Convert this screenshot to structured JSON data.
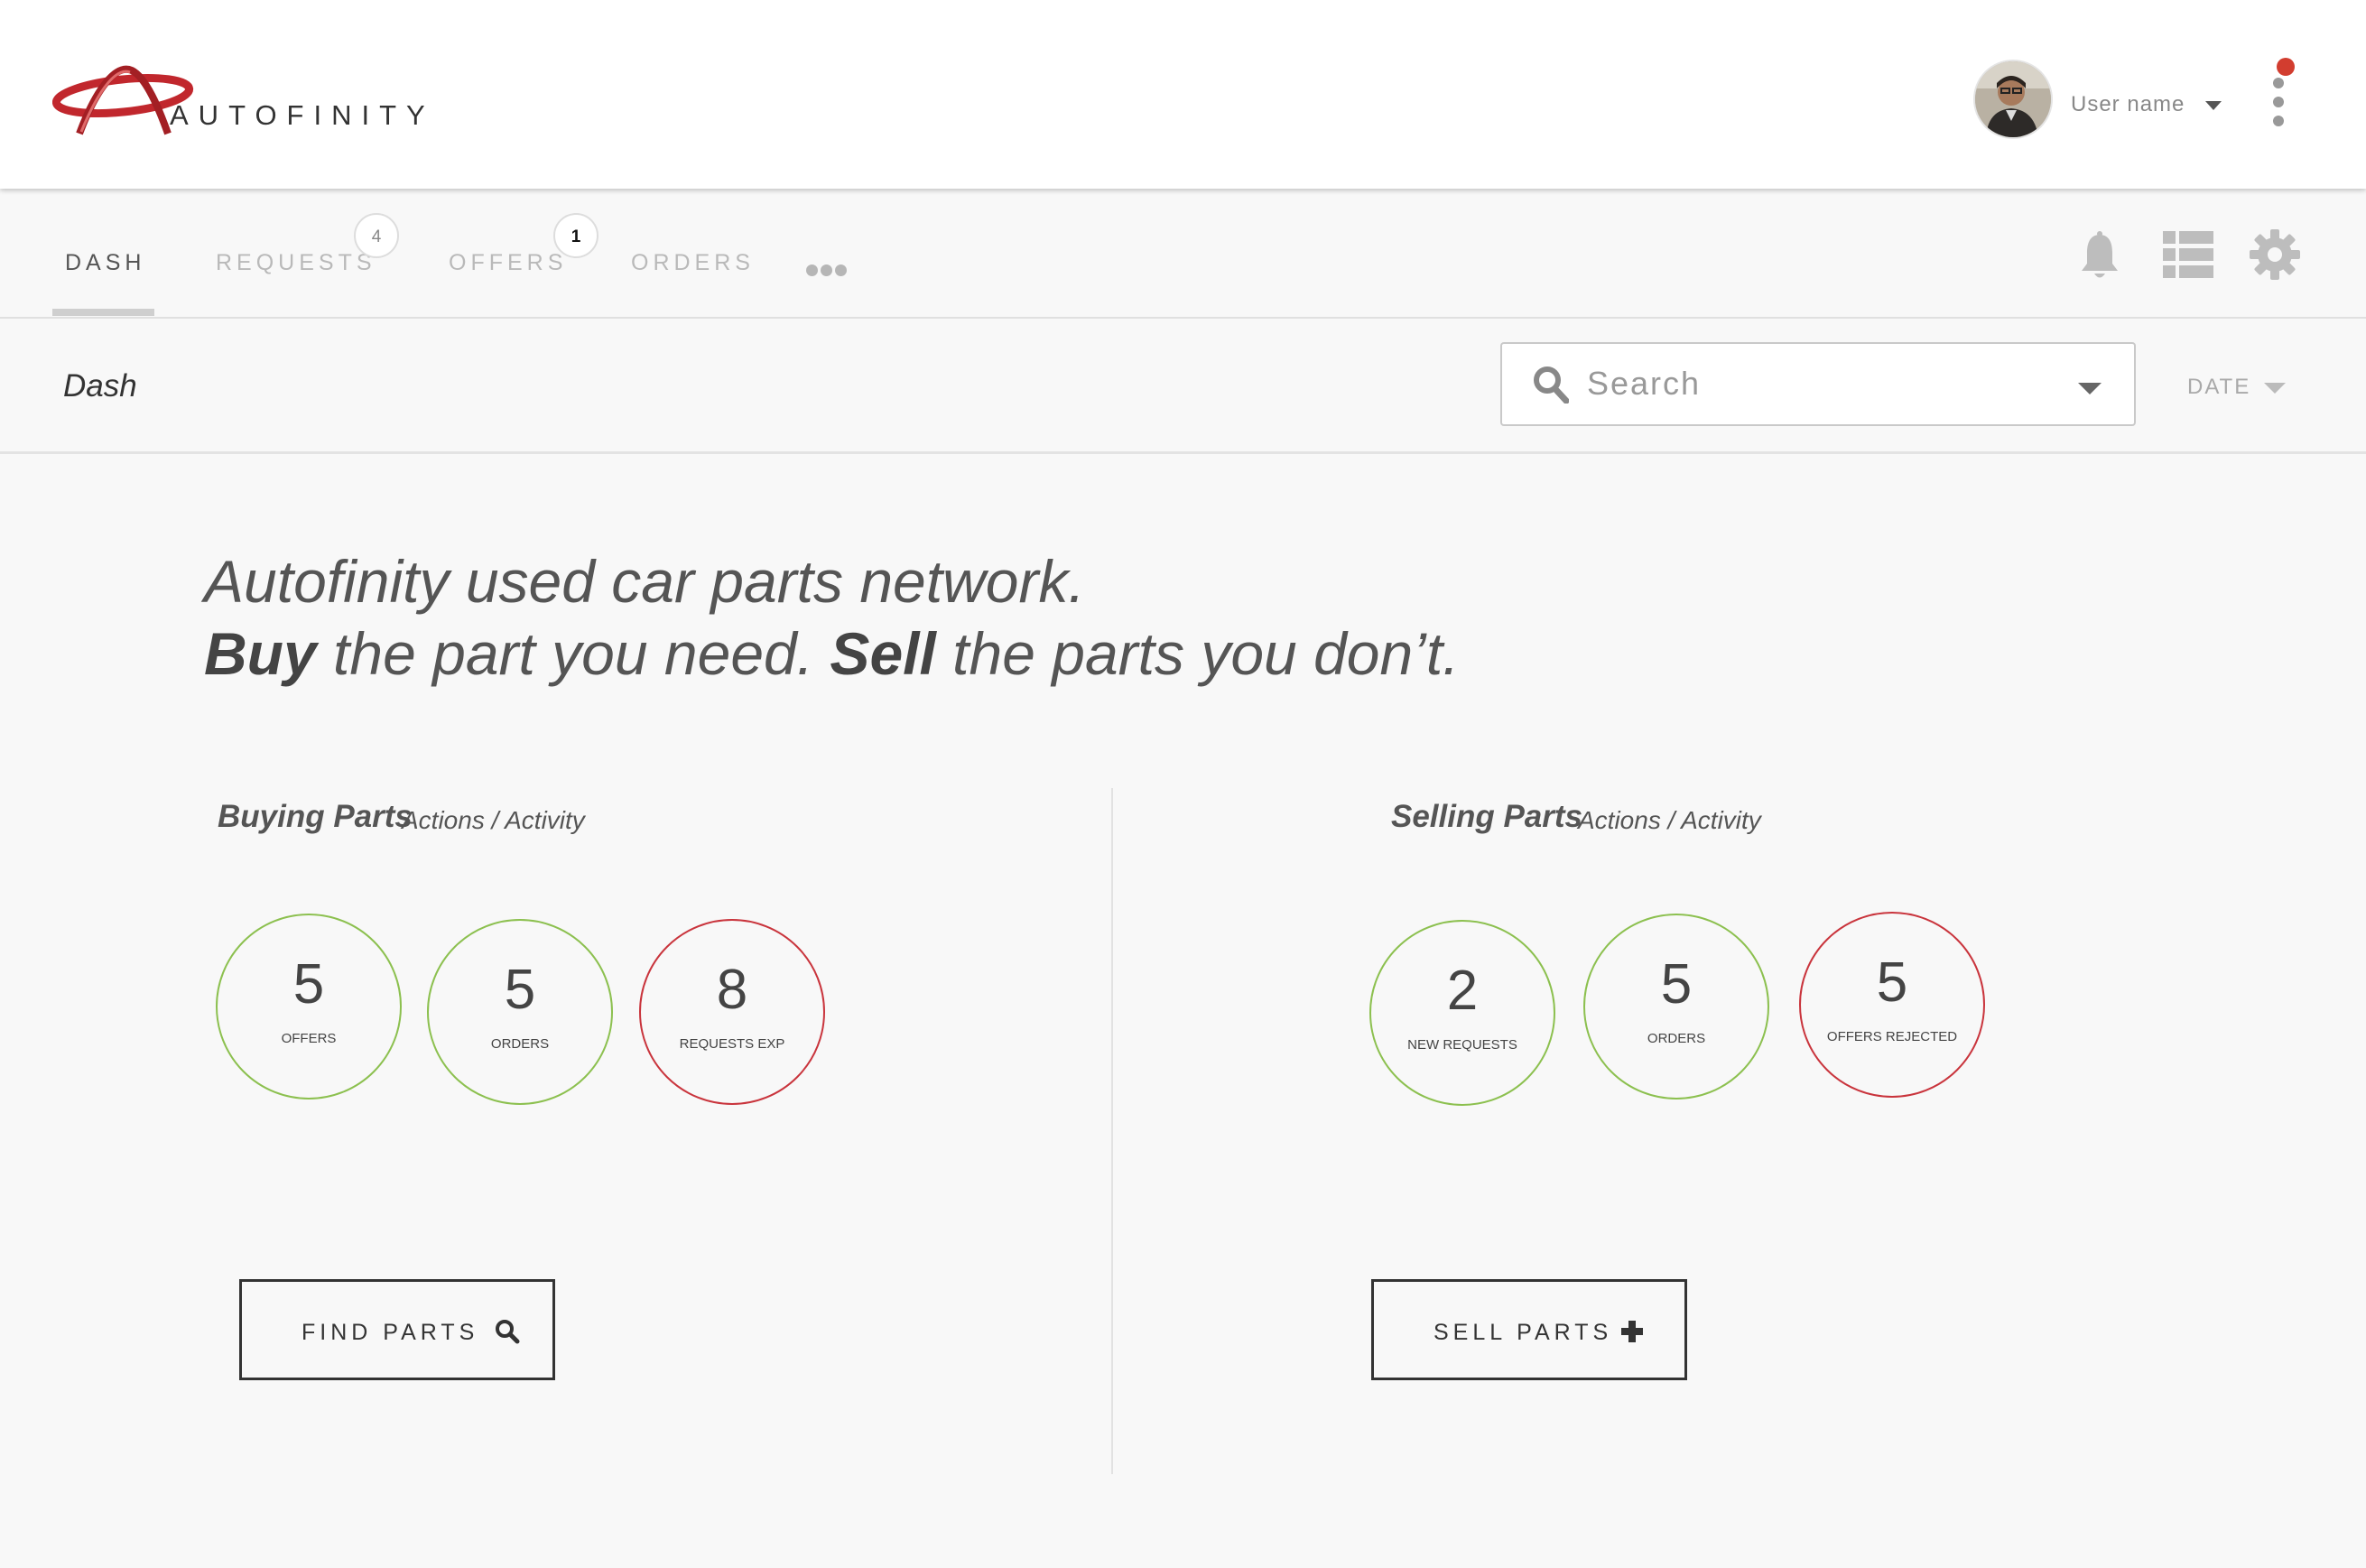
{
  "header": {
    "logo_text": "AUTOFINITY",
    "user_name": "User name"
  },
  "tabs": [
    {
      "label": "DASH"
    },
    {
      "label": "REQUESTS",
      "badge": "4"
    },
    {
      "label": "OFFERS",
      "badge": "1"
    },
    {
      "label": "ORDERS"
    }
  ],
  "toolbar_icons": [
    "more-dots-icon",
    "bell-icon",
    "list-icon",
    "gear-icon"
  ],
  "subheader": {
    "title": "Dash",
    "search_placeholder": "Search",
    "date_label": "DATE"
  },
  "tagline": {
    "line1": "Autofinity used car parts network.",
    "buy": "Buy",
    "buy_rest": " the part you need. ",
    "sell": "Sell",
    "sell_rest": " the parts you don’t."
  },
  "buying": {
    "title": "Buying Parts",
    "subtitle": "Actions / Activity",
    "stats": [
      {
        "value": "5",
        "label": "OFFERS",
        "status": "green"
      },
      {
        "value": "5",
        "label": "ORDERS",
        "status": "green"
      },
      {
        "value": "8",
        "label": "REQUESTS EXP",
        "status": "red"
      }
    ],
    "button_label": "FIND PARTS"
  },
  "selling": {
    "title": "Selling Parts",
    "subtitle": "Actions / Activity",
    "stats": [
      {
        "value": "2",
        "label": "NEW REQUESTS",
        "status": "green"
      },
      {
        "value": "5",
        "label": "ORDERS",
        "status": "green"
      },
      {
        "value": "5",
        "label": "OFFERS REJECTED",
        "status": "red"
      }
    ],
    "button_label": "SELL PARTS"
  },
  "colors": {
    "green": "#8cc04f",
    "red": "#c9343c",
    "notification": "#d23d2f",
    "logo_red": "#c1272d"
  }
}
